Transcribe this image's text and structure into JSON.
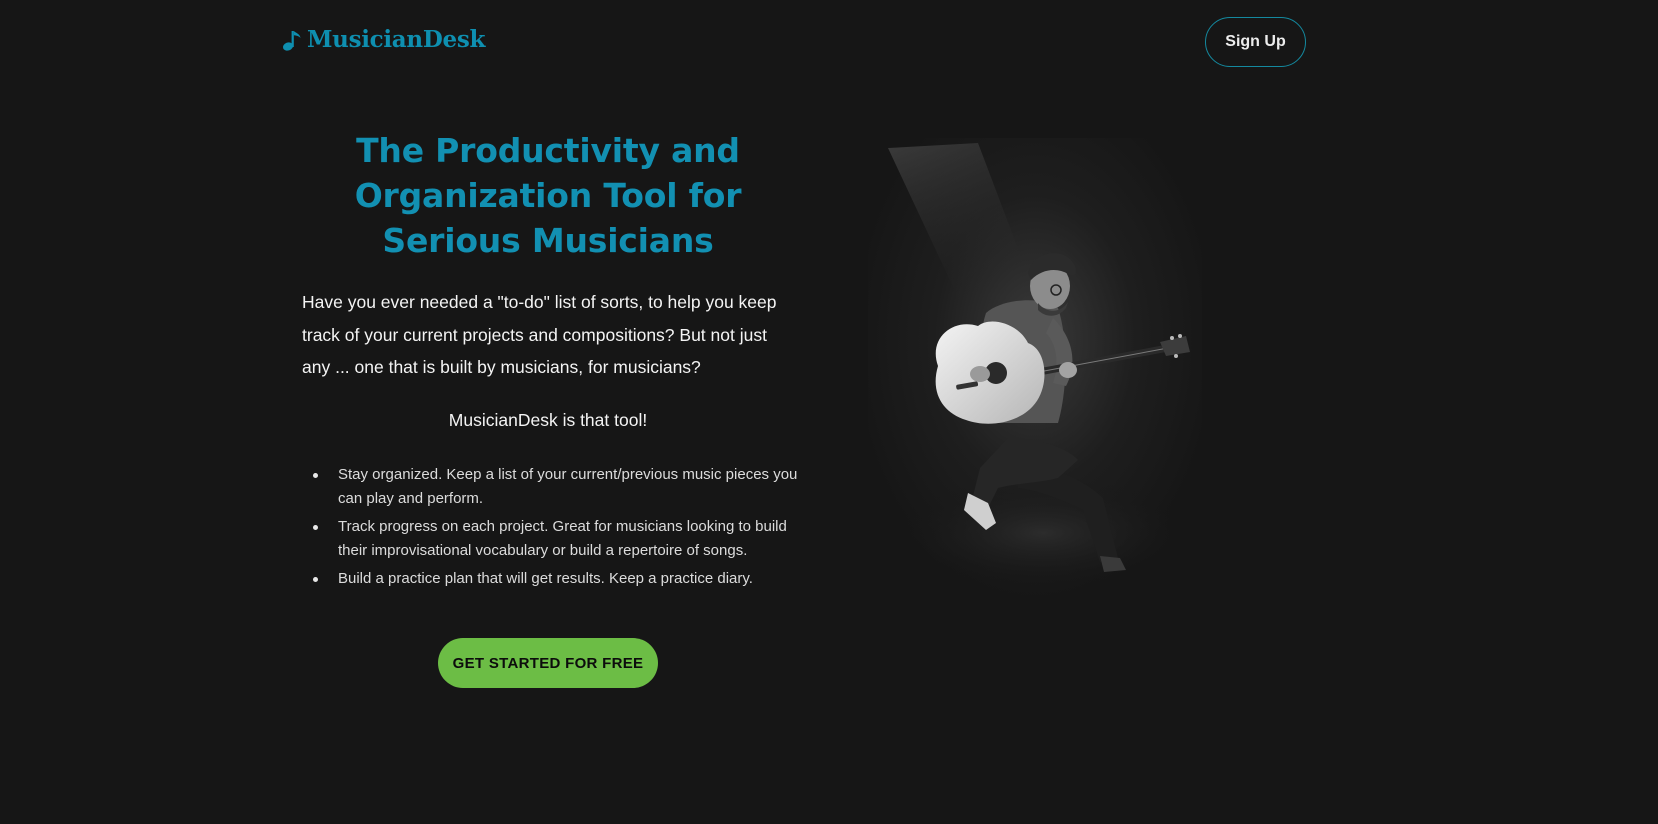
{
  "header": {
    "logo_text": "MusicianDesk",
    "logo_icon": "music-note-icon",
    "signup_label": "Sign Up"
  },
  "hero": {
    "title_lines": [
      "The Productivity and",
      "Organization Tool for",
      "Serious Musicians"
    ],
    "intro": "Have you ever needed a \"to-do\" list of sorts, to help you keep track of your current projects and compositions? But not just any ... one that is built by musicians, for musicians?",
    "tagline": "MusicianDesk is that tool!",
    "features": [
      "Stay organized. Keep a list of your current/previous music pieces you can play and perform.",
      "Track progress on each project. Great for musicians looking to build their improvisational vocabulary or build a repertoire of songs.",
      "Build a practice plan that will get results. Keep a practice diary."
    ],
    "cta_label": "GET STARTED FOR FREE",
    "image_subject": "guitarist-photo"
  },
  "colors": {
    "background": "#161616",
    "brand": "#1290b2",
    "cta": "#6cbd45",
    "signup_border": "#14899f"
  }
}
